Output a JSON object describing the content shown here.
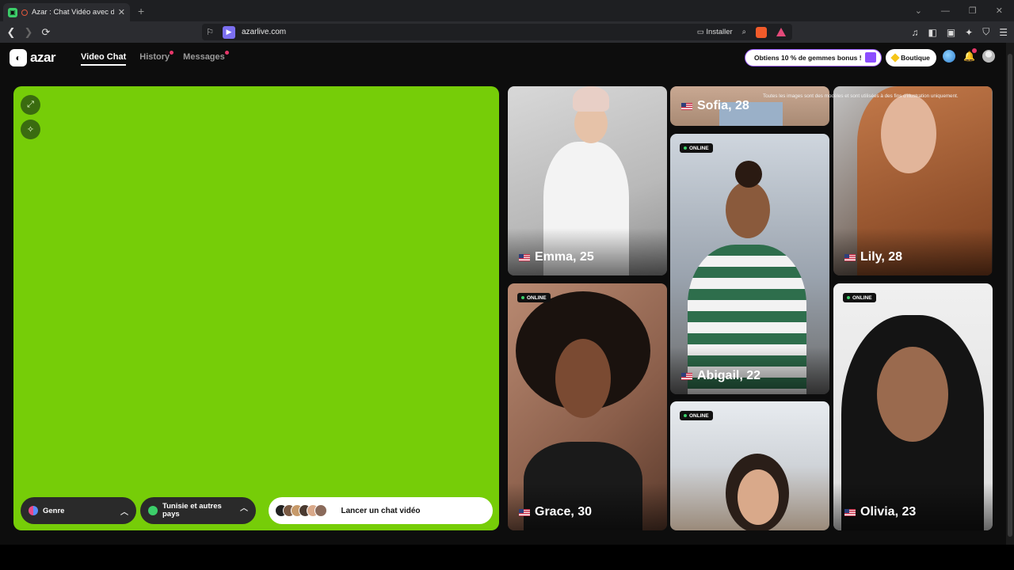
{
  "browser": {
    "tab_title": "Azar : Chat Vidéo avec de no",
    "tab_close": "✕",
    "new_tab": "+",
    "url": "azarlive.com",
    "install_label": "Installer",
    "win_min": "—",
    "win_max": "❐",
    "win_close": "✕",
    "win_down": "⌄"
  },
  "app": {
    "logo_text": "azar",
    "nav": [
      {
        "label": "Video Chat"
      },
      {
        "label": "History"
      },
      {
        "label": "Messages"
      }
    ],
    "promo_label": "Obtiens 10 % de gemmes bonus !",
    "shop_label": "Boutique"
  },
  "video_panel": {
    "genre_label": "Genre",
    "country_label": "Tunisie et autres pays",
    "launch_label": "Lancer un chat vidéo"
  },
  "disclaimer": "Toutes les images sont des modèles et sont utilisées à des fins d'illustration uniquement.",
  "profiles": [
    {
      "name": "Emma, 25",
      "online": false,
      "country": "US"
    },
    {
      "name": "Sofia, 28",
      "online": false,
      "country": "US"
    },
    {
      "name": "Lily, 28",
      "online": false,
      "country": "US"
    },
    {
      "name": "Abigail, 22",
      "online": true,
      "country": "US"
    },
    {
      "name": "Grace, 30",
      "online": true,
      "country": "US"
    },
    {
      "name": "Olivia, 23",
      "online": true,
      "country": "US"
    },
    {
      "name": "",
      "online": true,
      "country": "US"
    }
  ],
  "online_label": "ONLINE",
  "colors": {
    "video_bg": "#76cd08",
    "accent_purple": "#9c5cff",
    "notif_dot": "#e8376a",
    "online_dot": "#3ccf6a"
  }
}
